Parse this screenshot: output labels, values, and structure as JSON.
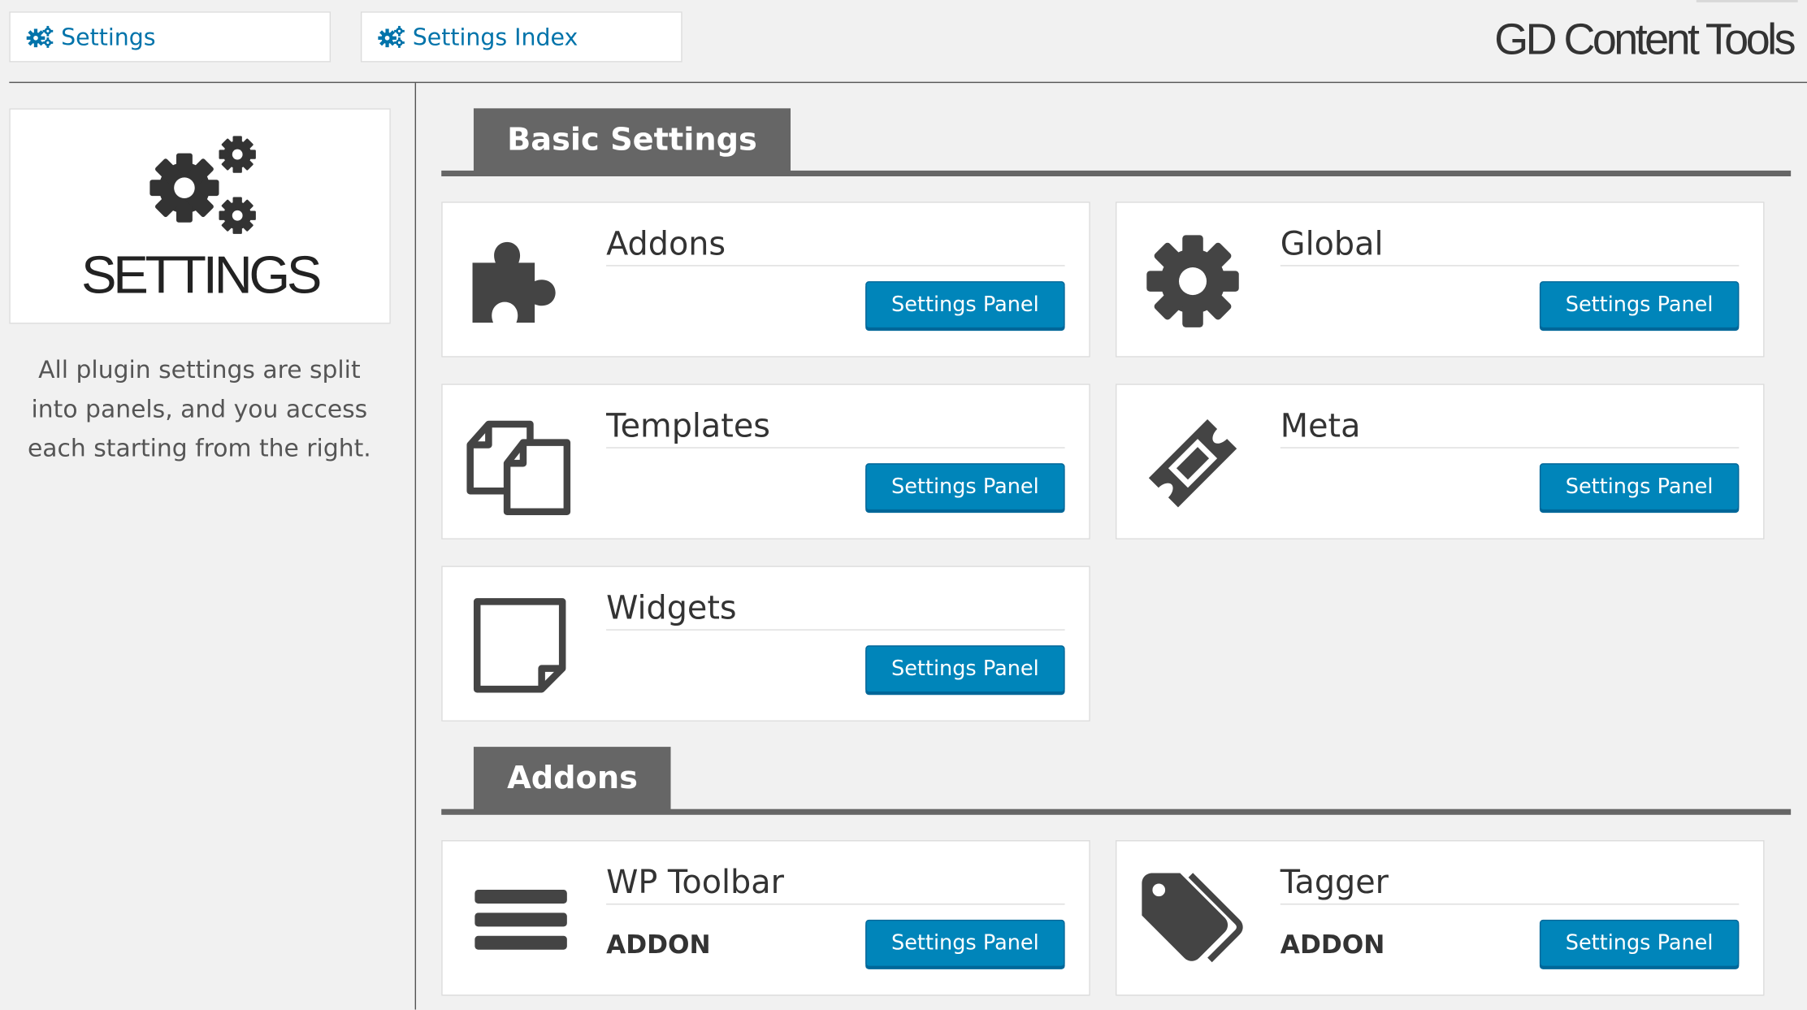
{
  "top_tabs": [
    {
      "label": "Settings",
      "icon": "cogs-icon"
    },
    {
      "label": "Settings Index",
      "icon": "cogs-icon"
    }
  ],
  "brand": "GD Content Tools",
  "sidebar": {
    "title": "SETTINGS",
    "description": "All plugin settings are split into panels, and you access each starting from the right."
  },
  "sections": [
    {
      "title": "Basic Settings",
      "panels": [
        {
          "title": "Addons",
          "icon": "puzzle-icon",
          "button": "Settings Panel"
        },
        {
          "title": "Global",
          "icon": "gear-icon",
          "button": "Settings Panel"
        },
        {
          "title": "Templates",
          "icon": "copy-files-icon",
          "button": "Settings Panel"
        },
        {
          "title": "Meta",
          "icon": "ticket-icon",
          "button": "Settings Panel"
        },
        {
          "title": "Widgets",
          "icon": "sticky-note-icon",
          "button": "Settings Panel"
        }
      ]
    },
    {
      "title": "Addons",
      "panels": [
        {
          "title": "WP Toolbar",
          "icon": "bars-icon",
          "tag": "ADDON",
          "button": "Settings Panel"
        },
        {
          "title": "Tagger",
          "icon": "tags-icon",
          "tag": "ADDON",
          "button": "Settings Panel"
        }
      ]
    }
  ],
  "colors": {
    "link": "#0073aa",
    "button": "#0085ba",
    "section_tab": "#666666",
    "icon": "#444444"
  }
}
